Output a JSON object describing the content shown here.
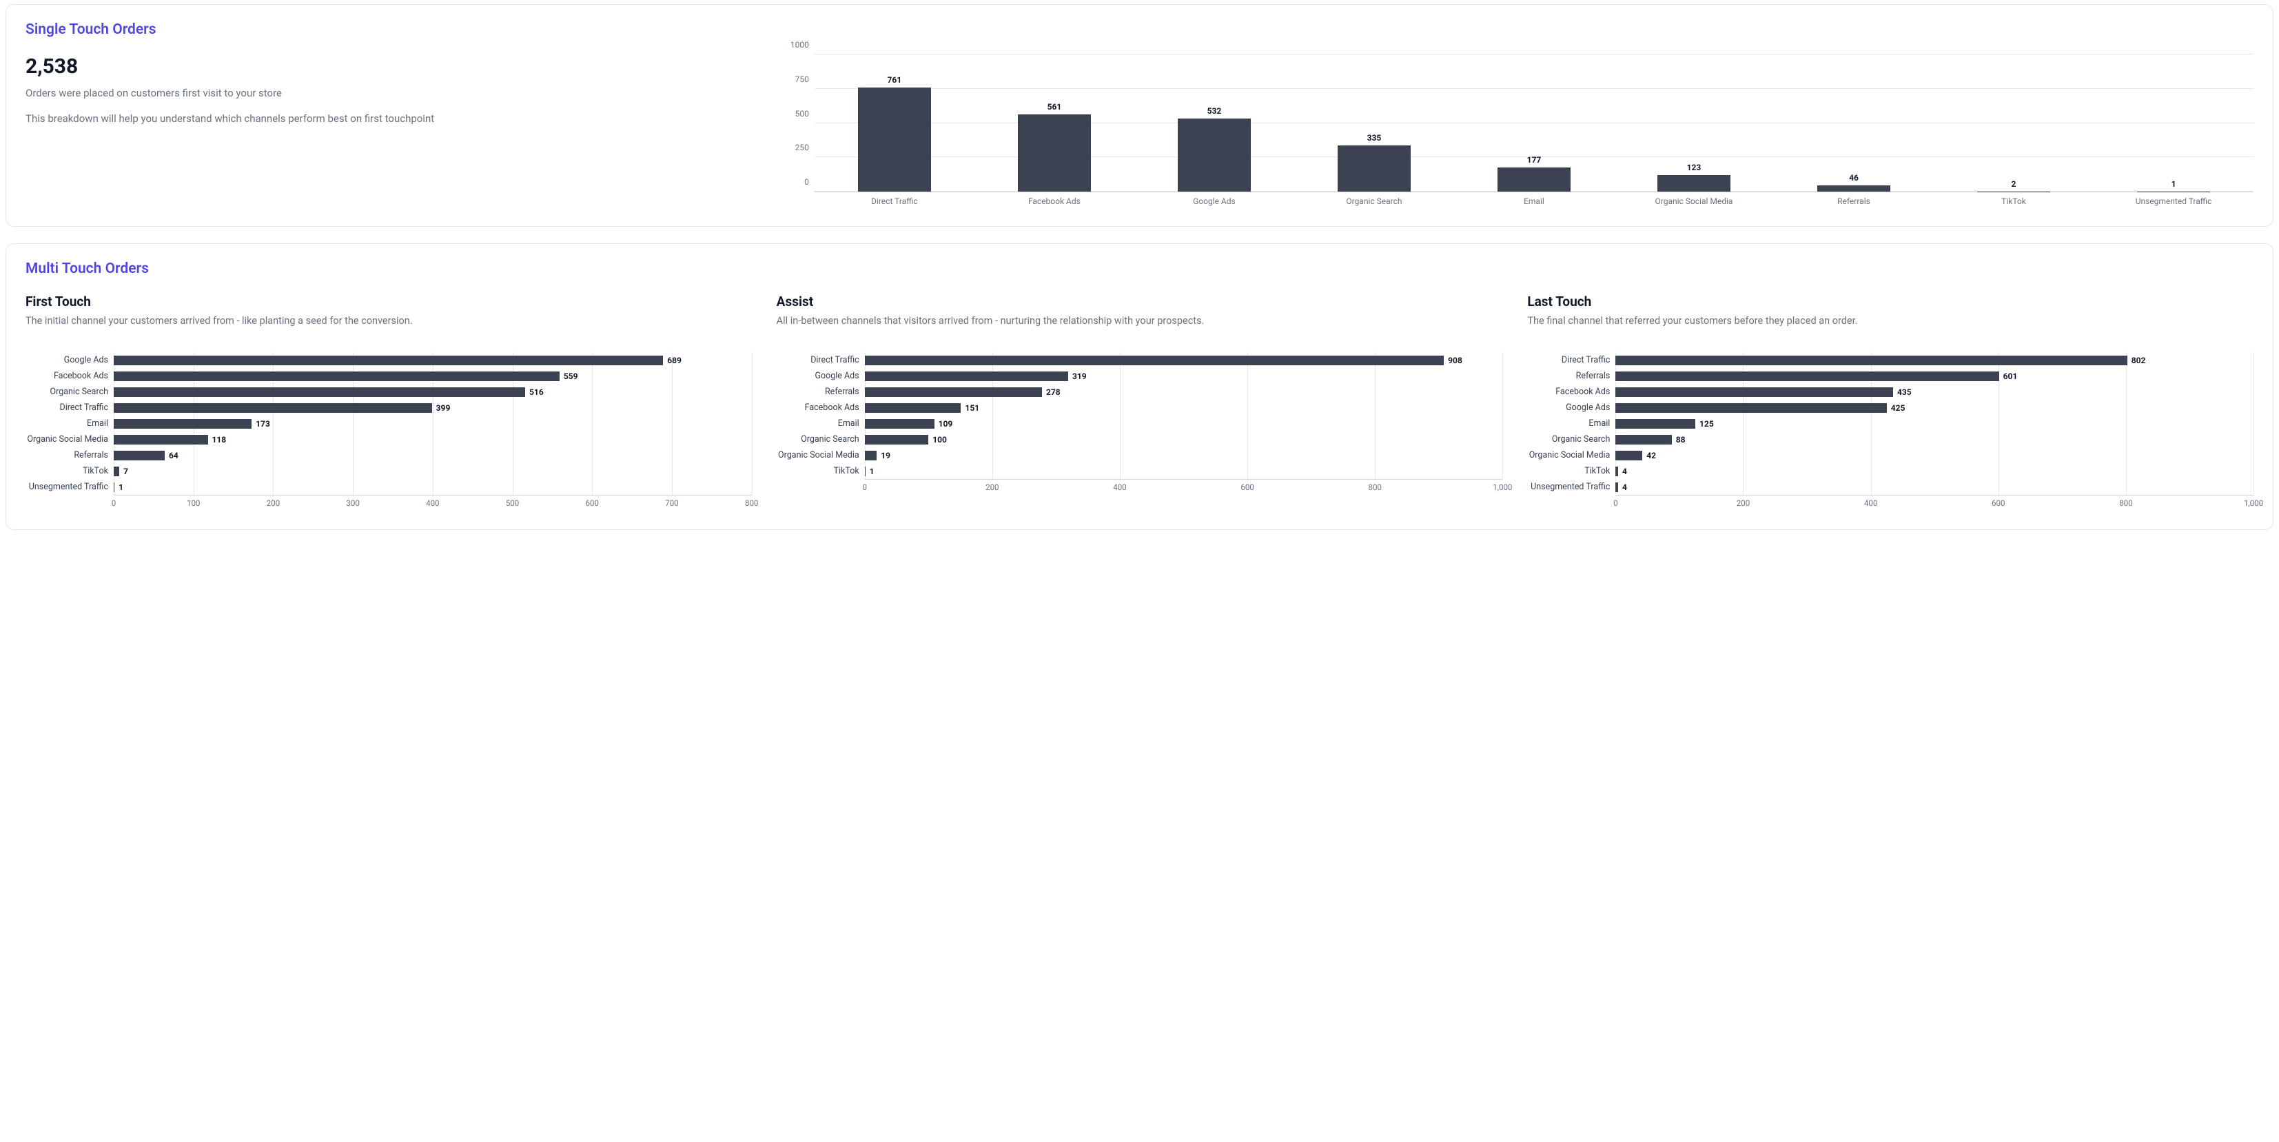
{
  "single": {
    "title": "Single Touch Orders",
    "big_number": "2,538",
    "line1": "Orders were placed on customers first visit to your store",
    "line2": "This breakdown will help you understand which channels perform best on first touchpoint"
  },
  "multi": {
    "title": "Multi Touch Orders",
    "first": {
      "title": "First Touch",
      "desc": "The initial channel your customers arrived from - like planting a seed for the conversion."
    },
    "assist": {
      "title": "Assist",
      "desc": "All in-between channels that visitors arrived from - nurturing the relationship with your prospects."
    },
    "last": {
      "title": "Last Touch",
      "desc": "The final channel that referred your customers before they placed an order."
    }
  },
  "chart_data": [
    {
      "id": "single_touch",
      "type": "bar",
      "orientation": "vertical",
      "title": "Single Touch Orders",
      "ylim": [
        0,
        1000
      ],
      "yticks": [
        0,
        250,
        500,
        750,
        1000
      ],
      "categories": [
        "Direct Traffic",
        "Facebook Ads",
        "Google Ads",
        "Organic Search",
        "Email",
        "Organic Social Media",
        "Referrals",
        "TikTok",
        "Unsegmented Traffic"
      ],
      "values": [
        761,
        561,
        532,
        335,
        177,
        123,
        46,
        2,
        1
      ]
    },
    {
      "id": "first_touch",
      "type": "bar",
      "orientation": "horizontal",
      "title": "First Touch",
      "xlim": [
        0,
        800
      ],
      "xticks": [
        0,
        100,
        200,
        300,
        400,
        500,
        600,
        700,
        800
      ],
      "categories": [
        "Google Ads",
        "Facebook Ads",
        "Organic Search",
        "Direct Traffic",
        "Email",
        "Organic Social Media",
        "Referrals",
        "TikTok",
        "Unsegmented Traffic"
      ],
      "values": [
        689,
        559,
        516,
        399,
        173,
        118,
        64,
        7,
        1
      ]
    },
    {
      "id": "assist",
      "type": "bar",
      "orientation": "horizontal",
      "title": "Assist",
      "xlim": [
        0,
        1000
      ],
      "xticks": [
        0,
        200,
        400,
        600,
        800,
        1000
      ],
      "xtick_labels": [
        "0",
        "200",
        "400",
        "600",
        "800",
        "1,000"
      ],
      "categories": [
        "Direct Traffic",
        "Google Ads",
        "Referrals",
        "Facebook Ads",
        "Email",
        "Organic Search",
        "Organic Social Media",
        "TikTok"
      ],
      "values": [
        908,
        319,
        278,
        151,
        109,
        100,
        19,
        1
      ]
    },
    {
      "id": "last_touch",
      "type": "bar",
      "orientation": "horizontal",
      "title": "Last Touch",
      "xlim": [
        0,
        1000
      ],
      "xticks": [
        0,
        200,
        400,
        600,
        800,
        1000
      ],
      "xtick_labels": [
        "0",
        "200",
        "400",
        "600",
        "800",
        "1,000"
      ],
      "categories": [
        "Direct Traffic",
        "Referrals",
        "Facebook Ads",
        "Google Ads",
        "Email",
        "Organic Search",
        "Organic Social Media",
        "TikTok",
        "Unsegmented Traffic"
      ],
      "values": [
        802,
        601,
        435,
        425,
        125,
        88,
        42,
        4,
        4
      ]
    }
  ]
}
